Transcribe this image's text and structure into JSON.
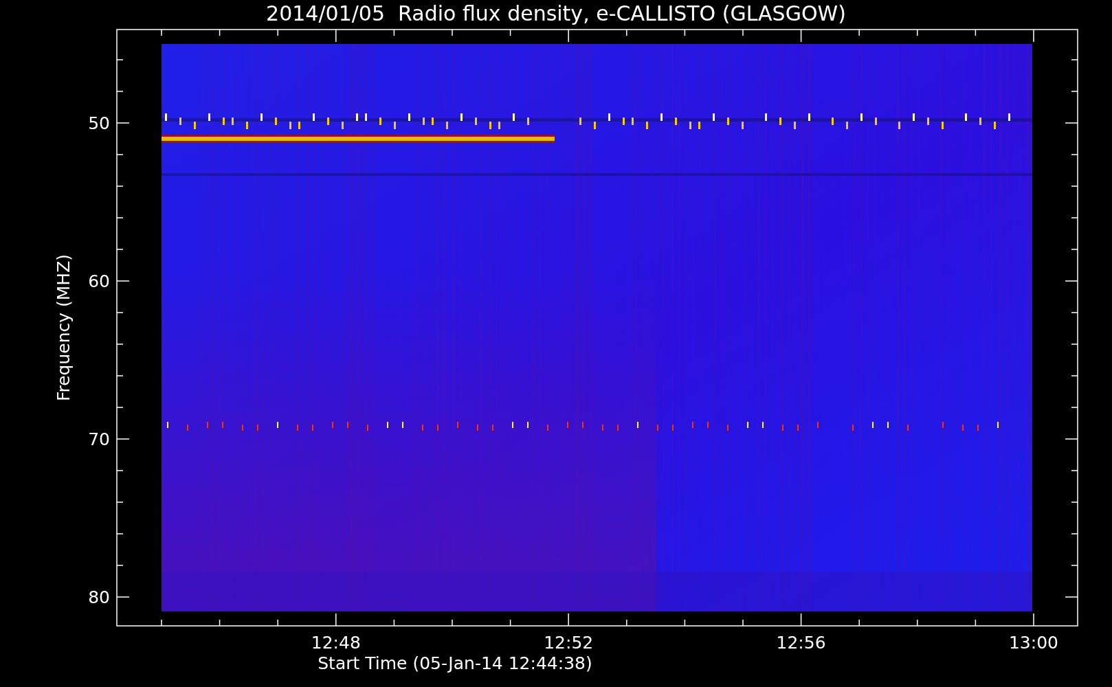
{
  "title": "2014/01/05  Radio flux density, e-CALLISTO (GLASGOW)",
  "plot": {
    "ylabel": "Frequency (MHZ)",
    "xlabel": "Start Time (05-Jan-14 12:44:38)",
    "yticks": [
      "50",
      "60",
      "70",
      "80"
    ],
    "xticks": [
      "12:48",
      "12:52",
      "12:56",
      "13:00"
    ]
  }
}
